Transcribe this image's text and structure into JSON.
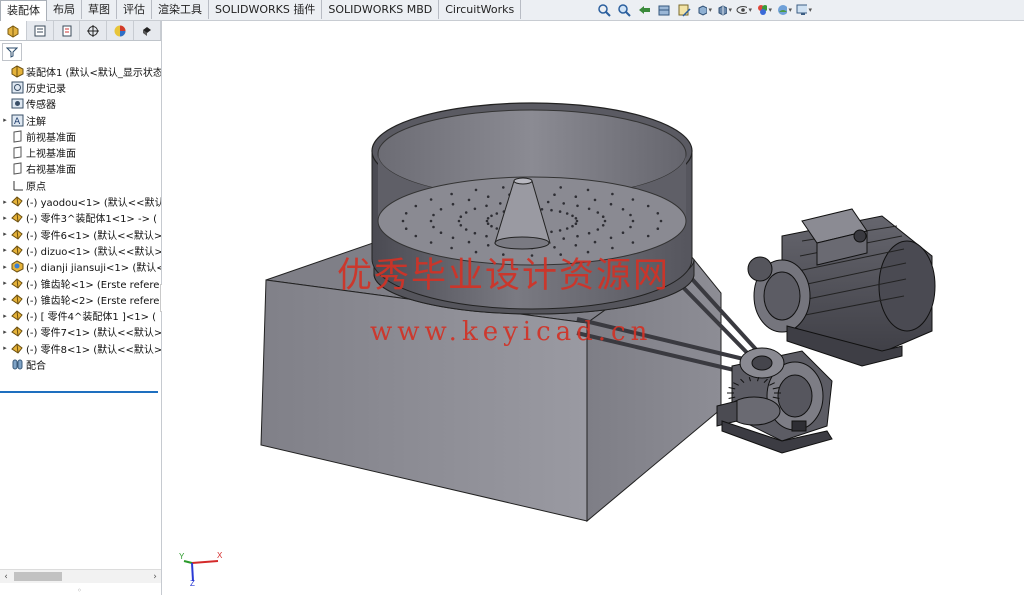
{
  "command_tabs": [
    "装配体",
    "布局",
    "草图",
    "评估",
    "渲染工具",
    "SOLIDWORKS 插件",
    "SOLIDWORKS MBD",
    "CircuitWorks"
  ],
  "view_toolbar_icons": [
    "zoom-to-fit-icon",
    "zoom-to-area-icon",
    "previous-view-icon",
    "section-view-icon",
    "dynamic-annotation-icon",
    "view-orientation-icon",
    "display-style-icon",
    "hide-show-items-icon",
    "edit-appearance-icon",
    "apply-scene-icon",
    "view-settings-icon"
  ],
  "feature_manager_tabs": [
    "featuremanager-tab-icon",
    "propertymanager-tab-icon",
    "configurationmanager-tab-icon",
    "dimxpertmanager-tab-icon",
    "displaymanager-tab-icon",
    "cam-tab-icon"
  ],
  "tree": [
    {
      "label": "装配体1  (默认<默认_显示状态-",
      "icon": "assembly-icon",
      "expand": false
    },
    {
      "label": "历史记录",
      "icon": "history-icon",
      "expand": false
    },
    {
      "label": "传感器",
      "icon": "sensor-icon",
      "expand": false
    },
    {
      "label": "注解",
      "icon": "annotation-icon",
      "expand": true
    },
    {
      "label": "前视基准面",
      "icon": "plane-icon",
      "expand": false
    },
    {
      "label": "上视基准面",
      "icon": "plane-icon",
      "expand": false
    },
    {
      "label": "右视基准面",
      "icon": "plane-icon",
      "expand": false
    },
    {
      "label": "原点",
      "icon": "origin-icon",
      "expand": false
    },
    {
      "label": "(-) yaodou<1> (默认<<默认",
      "icon": "part-icon",
      "expand": true
    },
    {
      "label": "(-) 零件3^装配体1<1> -> (",
      "icon": "part-icon",
      "expand": true
    },
    {
      "label": "(-) 零件6<1> (默认<<默认>",
      "icon": "part-icon",
      "expand": true
    },
    {
      "label": "(-) dizuo<1> (默认<<默认>",
      "icon": "part-icon",
      "expand": true
    },
    {
      "label": "(-) dianji jiansuji<1> (默认<",
      "icon": "subassembly-icon",
      "expand": true
    },
    {
      "label": "(-) 锥齿轮<1> (Erste refere",
      "icon": "part-icon",
      "expand": true
    },
    {
      "label": "(-) 锥齿轮<2> (Erste refere",
      "icon": "part-icon",
      "expand": true
    },
    {
      "label": "(-) [ 零件4^装配体1 ]<1> (",
      "icon": "part-icon",
      "expand": true
    },
    {
      "label": "(-) 零件7<1> (默认<<默认>",
      "icon": "part-icon",
      "expand": true
    },
    {
      "label": "(-) 零件8<1> (默认<<默认>",
      "icon": "part-icon",
      "expand": true
    },
    {
      "label": "配合",
      "icon": "mates-icon",
      "expand": false
    }
  ],
  "watermark": {
    "title": "优秀毕业设计资源网",
    "url": "www.keyicad.cn"
  },
  "triad": {
    "x": "X",
    "y": "Y",
    "z": "Z"
  },
  "colors": {
    "accent": "#1e6fbf",
    "watermark": "#d23226",
    "part_gray": "#8e8e95"
  }
}
